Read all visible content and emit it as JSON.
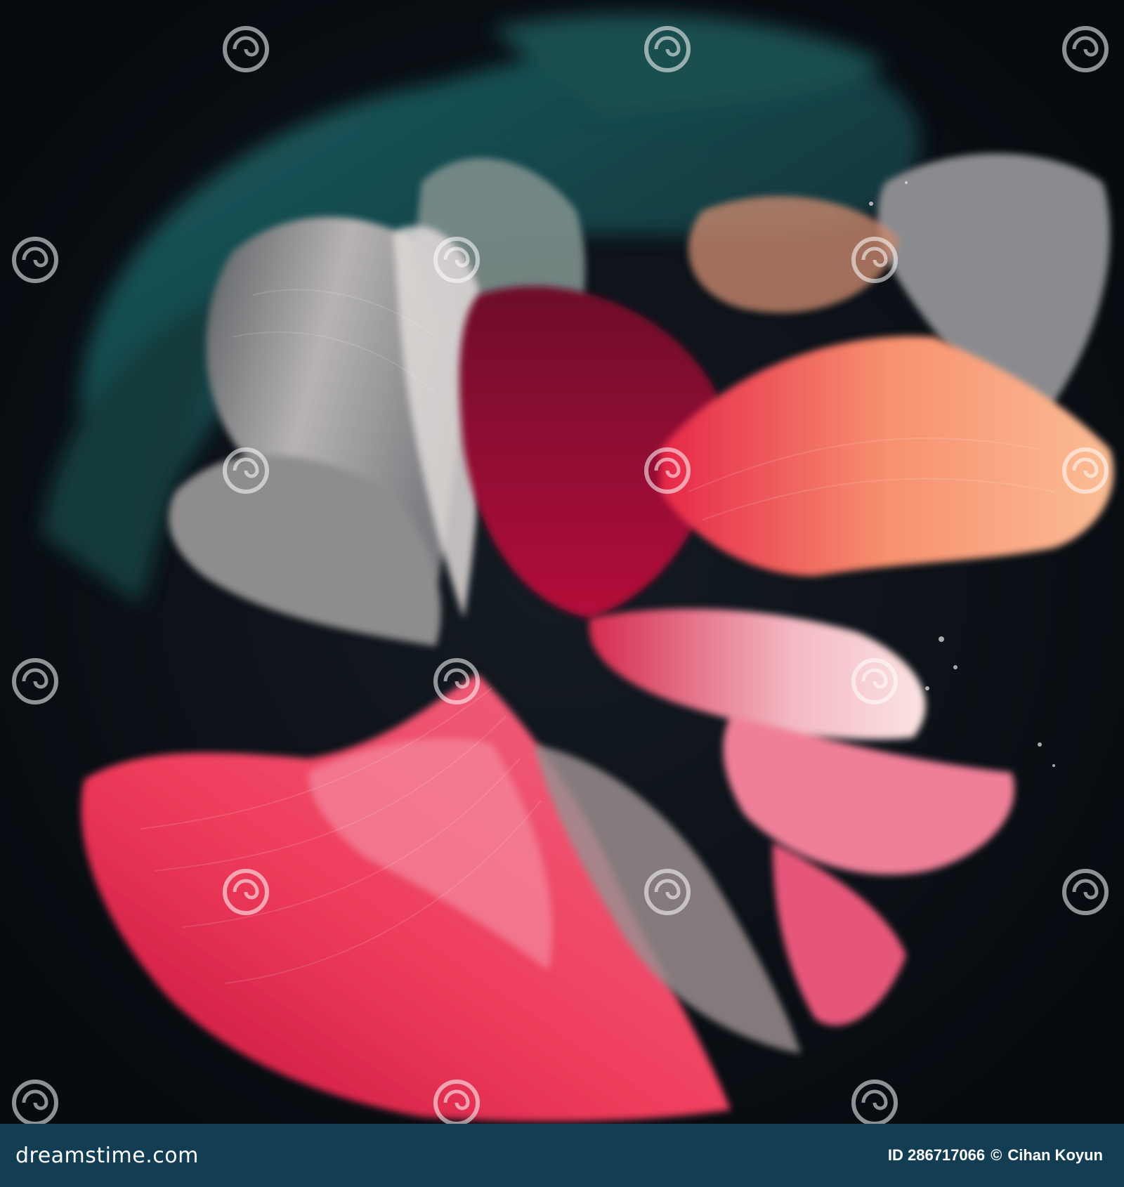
{
  "watermark": {
    "text": "dreamstime",
    "color": "#ffffff",
    "icon": "spiral-icon"
  },
  "footer": {
    "site": "dreamstime.com",
    "image_id": "ID 286717066",
    "copyright_symbol": "©",
    "author": "Cihan Koyun",
    "background": "#123d52"
  },
  "palette": {
    "background": "#0b1016",
    "teal": "#1d5a5e",
    "grey": "#8d8f93",
    "crimson": "#d8173e",
    "pink": "#ef6e8a",
    "peach": "#f7a889"
  }
}
